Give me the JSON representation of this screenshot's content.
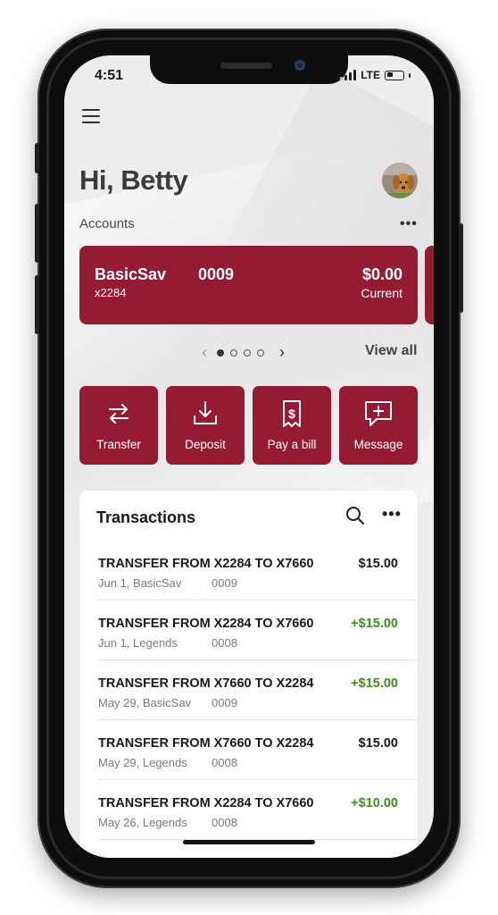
{
  "status_bar": {
    "time": "4:51",
    "network": "LTE"
  },
  "header": {
    "greeting": "Hi, Betty"
  },
  "accounts": {
    "label": "Accounts",
    "more": "•••",
    "card": {
      "name": "BasicSav",
      "number": "x2284",
      "last4": "0009",
      "balance": "$0.00",
      "type": "Current"
    },
    "pager": {
      "prev": "‹",
      "next": "›",
      "pages": 4,
      "active_page": 1
    },
    "view_all": "View all"
  },
  "actions": [
    {
      "label": "Transfer",
      "icon": "transfer-icon"
    },
    {
      "label": "Deposit",
      "icon": "deposit-icon"
    },
    {
      "label": "Pay a bill",
      "icon": "pay-bill-icon"
    },
    {
      "label": "Message",
      "icon": "message-icon"
    }
  ],
  "transactions": {
    "title": "Transactions",
    "more": "•••",
    "items": [
      {
        "description": "TRANSFER FROM X2284 TO X7660",
        "date": "Jun 1, BasicSav",
        "ref": "0009",
        "amount": "$15.00"
      },
      {
        "description": "TRANSFER FROM X2284 TO X7660",
        "date": "Jun 1, Legends",
        "ref": "0008",
        "amount": "+$15.00"
      },
      {
        "description": "TRANSFER FROM X7660 TO X2284",
        "date": "May 29, BasicSav",
        "ref": "0009",
        "amount": "+$15.00"
      },
      {
        "description": "TRANSFER FROM X7660 TO X2284",
        "date": "May 29, Legends",
        "ref": "0008",
        "amount": "$15.00"
      },
      {
        "description": "TRANSFER FROM X2284 TO X7660",
        "date": "May 26, Legends",
        "ref": "0008",
        "amount": "+$10.00"
      }
    ]
  },
  "colors": {
    "brand": "#951b33",
    "credit": "#3e8f1c",
    "background": "#ededed"
  }
}
